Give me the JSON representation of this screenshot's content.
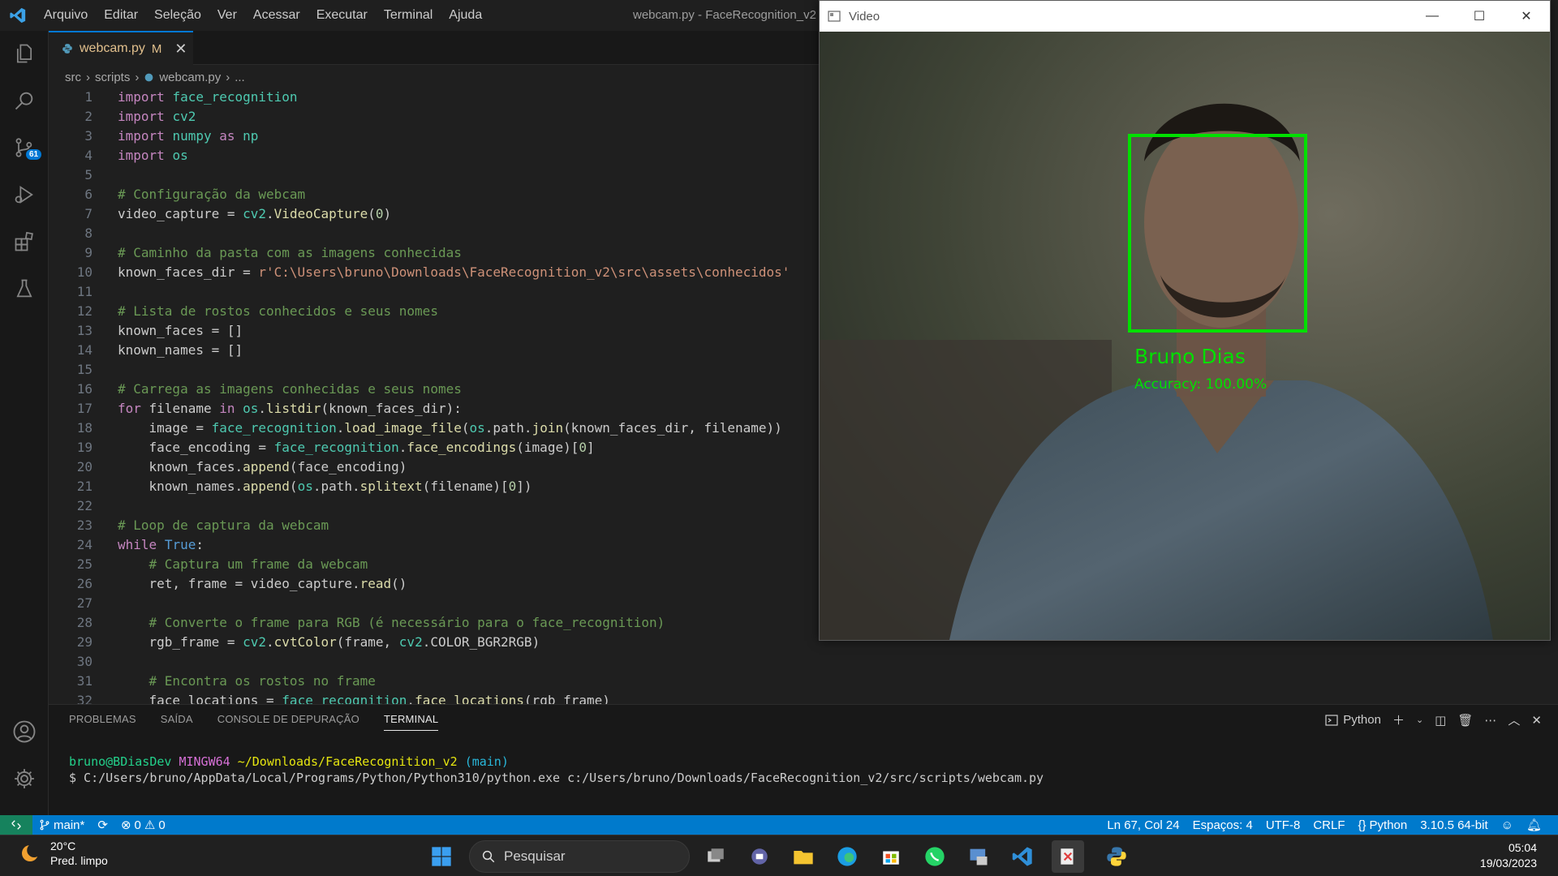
{
  "titlebar": {
    "menu": [
      "Arquivo",
      "Editar",
      "Seleção",
      "Ver",
      "Acessar",
      "Executar",
      "Terminal",
      "Ajuda"
    ],
    "title": "webcam.py - FaceRecognition_v2 -"
  },
  "activity": {
    "source_control_badge": "61"
  },
  "tab": {
    "filename": "webcam.py",
    "modified": "M"
  },
  "breadcrumb": [
    "src",
    "scripts",
    "webcam.py",
    "..."
  ],
  "code_lines": [
    "import face_recognition",
    "import cv2",
    "import numpy as np",
    "import os",
    "",
    "# Configuração da webcam",
    "video_capture = cv2.VideoCapture(0)",
    "",
    "# Caminho da pasta com as imagens conhecidas",
    "known_faces_dir = r'C:\\Users\\bruno\\Downloads\\FaceRecognition_v2\\src\\assets\\conhecidos'",
    "",
    "# Lista de rostos conhecidos e seus nomes",
    "known_faces = []",
    "known_names = []",
    "",
    "# Carrega as imagens conhecidas e seus nomes",
    "for filename in os.listdir(known_faces_dir):",
    "    image = face_recognition.load_image_file(os.path.join(known_faces_dir, filename))",
    "    face_encoding = face_recognition.face_encodings(image)[0]",
    "    known_faces.append(face_encoding)",
    "    known_names.append(os.path.splitext(filename)[0])",
    "",
    "# Loop de captura da webcam",
    "while True:",
    "    # Captura um frame da webcam",
    "    ret, frame = video_capture.read()",
    "",
    "    # Converte o frame para RGB (é necessário para o face_recognition)",
    "    rgb_frame = cv2.cvtColor(frame, cv2.COLOR_BGR2RGB)",
    "",
    "    # Encontra os rostos no frame",
    "    face_locations = face_recognition.face_locations(rgb_frame)"
  ],
  "panel": {
    "tabs": [
      "PROBLEMAS",
      "SAÍDA",
      "CONSOLE DE DEPURAÇÃO",
      "TERMINAL"
    ],
    "shell_label": "Python",
    "terminal": {
      "user": "bruno@BDiasDev",
      "env": "MINGW64",
      "path": "~/Downloads/FaceRecognition_v2",
      "branch": "(main)",
      "command": "$ C:/Users/bruno/AppData/Local/Programs/Python/Python310/python.exe c:/Users/bruno/Downloads/FaceRecognition_v2/src/scripts/webcam.py"
    }
  },
  "statusbar": {
    "branch": "main*",
    "errors": "0",
    "warnings": "0",
    "position": "Ln 67, Col 24",
    "spaces": "Espaços: 4",
    "encoding": "UTF-8",
    "eol": "CRLF",
    "language": "Python",
    "interpreter": "3.10.5 64-bit"
  },
  "video": {
    "title": "Video",
    "name_label": "Bruno Dias",
    "accuracy_label": "Accuracy: 100.00%"
  },
  "taskbar": {
    "temperature": "20°C",
    "weather": "Pred. limpo",
    "search_placeholder": "Pesquisar",
    "time": "05:04",
    "date": "19/03/2023"
  },
  "colors": {
    "accent": "#0078d4",
    "statusbar": "#007acc",
    "detection_box": "#00e000"
  }
}
